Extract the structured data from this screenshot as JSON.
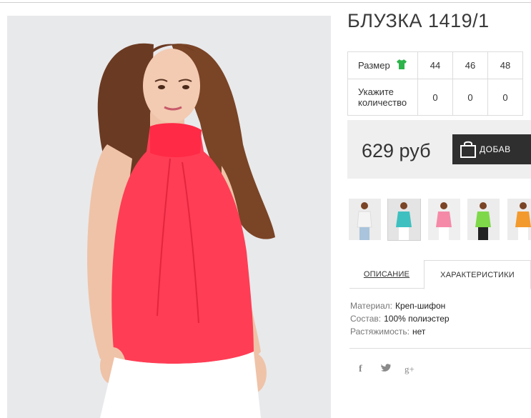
{
  "product": {
    "title": "БЛУЗКА 1419/1"
  },
  "size_table": {
    "size_label": "Размер",
    "size_icon": "shirt-icon",
    "size_icon_color": "#2db34a",
    "sizes": [
      "44",
      "46",
      "48"
    ],
    "qty_label_line1": "Укажите",
    "qty_label_line2": "количество",
    "quantities": [
      "0",
      "0",
      "0"
    ]
  },
  "price": {
    "text": "629 руб",
    "add_button_label": "ДОБАВ",
    "add_button_icon": "shopping-bag-icon"
  },
  "thumbnails": {
    "colors": [
      "#f4f4f4",
      "#3fc0c0",
      "#f58aa8",
      "#7fd84a",
      "#f39a2e"
    ],
    "active_index": 1
  },
  "tabs": {
    "description": "ОПИСАНИЕ",
    "characteristics": "ХАРАКТЕРИСТИКИ",
    "active": "characteristics"
  },
  "specs": [
    {
      "key": "Материал:",
      "value": "Креп-шифон"
    },
    {
      "key": "Состав:",
      "value": "100% полиэстер"
    },
    {
      "key": "Растяжимость:",
      "value": "нет"
    }
  ],
  "social": {
    "facebook": "f",
    "twitter_icon": "twitter-bird-icon",
    "google_plus": "g+"
  },
  "colors": {
    "blouse": "#ff3d55",
    "dark_button": "#2f2f2f",
    "price_bg": "#efefef"
  }
}
